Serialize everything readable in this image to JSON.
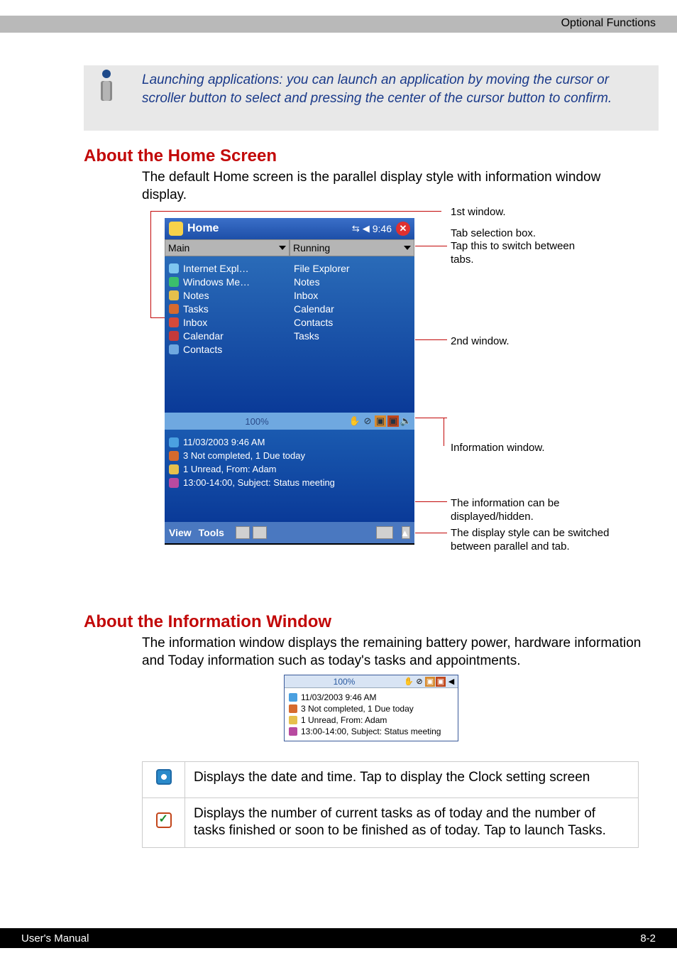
{
  "header": {
    "title": "Optional Functions"
  },
  "tip": "Launching applications: you can launch an application by moving the cursor or scroller button to select and pressing the center of the cursor button to confirm.",
  "h2a": "About the Home Screen",
  "body1": "The default Home screen is the parallel display style with information window display.",
  "annot": {
    "win1": "1st window.",
    "tab1": "Tab selection box.",
    "tab2": "Tap this to switch between tabs.",
    "win2": "2nd window.",
    "infowin": "Information window.",
    "hide1": "The information can be displayed/hidden.",
    "style1": "The display style can be switched between parallel and tab."
  },
  "shot1": {
    "title": "Home",
    "time": "9:46",
    "tab_left": "Main",
    "tab_right": "Running",
    "pane_left": [
      "Internet Expl…",
      "Windows Me…",
      "Notes",
      "Tasks",
      "Inbox",
      "Calendar",
      "Contacts"
    ],
    "pane_right": [
      "File Explorer",
      "Notes",
      "Inbox",
      "Calendar",
      "Contacts",
      "Tasks"
    ],
    "battery": "100%",
    "info": {
      "date": "11/03/2003 9:46 AM",
      "tasks": "3 Not completed, 1 Due today",
      "mail": "1 Unread, From: Adam",
      "appt": "13:00-14:00, Subject: Status meeting"
    },
    "menu": {
      "view": "View",
      "tools": "Tools"
    }
  },
  "h2b": "About the Information Window",
  "body2": "The information window displays the remaining battery power, hardware information and Today information such as today's tasks and appointments.",
  "shot2": {
    "battery": "100%",
    "date": "11/03/2003 9:46 AM",
    "tasks": "3 Not completed, 1 Due today",
    "mail": "1 Unread, From: Adam",
    "appt": "13:00-14:00, Subject: Status meeting"
  },
  "icon_table": {
    "row1": "Displays the date and time. Tap to display the Clock setting screen",
    "row2": "Displays the number of current tasks as of today and the number of tasks finished or soon to be finished as of today. Tap to launch Tasks."
  },
  "footer": {
    "left": "User's Manual",
    "right": "8-2"
  }
}
